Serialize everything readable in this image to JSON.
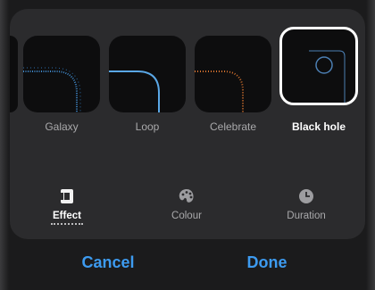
{
  "effects": [
    {
      "label": "Galaxy",
      "selected": false
    },
    {
      "label": "Loop",
      "selected": false
    },
    {
      "label": "Celebrate",
      "selected": false
    },
    {
      "label": "Black hole",
      "selected": true
    }
  ],
  "tabs": [
    {
      "label": "Effect",
      "icon": "effect-icon",
      "active": true
    },
    {
      "label": "Colour",
      "icon": "palette-icon",
      "active": false
    },
    {
      "label": "Duration",
      "icon": "clock-icon",
      "active": false
    }
  ],
  "actions": {
    "cancel": "Cancel",
    "done": "Done"
  },
  "colors": {
    "accent": "#3d9bf0",
    "panel": "#2b2b2d",
    "galaxy_glow": "#3f88c9",
    "loop_glow": "#5aa7e6",
    "celebrate_glow": "#d6722e",
    "black_hole_glow": "#4c7fb3"
  }
}
